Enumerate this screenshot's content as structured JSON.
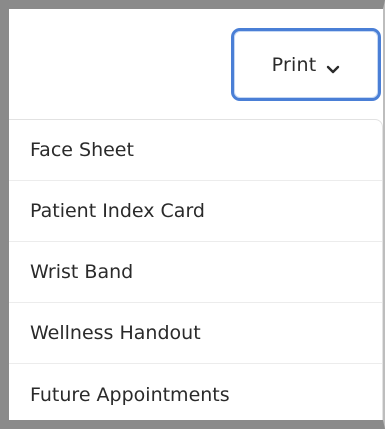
{
  "print_button": {
    "label": "Print",
    "icon": "chevron-down-icon",
    "border_color": "#4a7fd6"
  },
  "menu": {
    "items": [
      {
        "label": "Face Sheet"
      },
      {
        "label": "Patient Index Card"
      },
      {
        "label": "Wrist Band"
      },
      {
        "label": "Wellness Handout"
      },
      {
        "label": "Future Appointments"
      }
    ]
  }
}
